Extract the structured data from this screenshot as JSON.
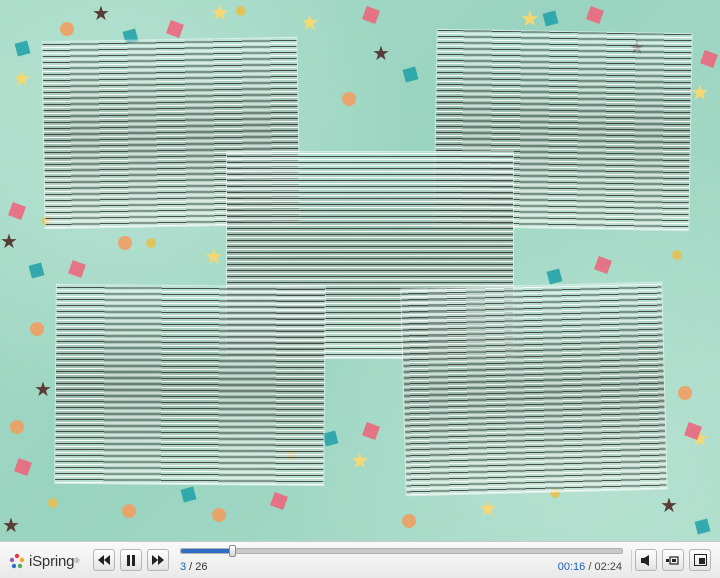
{
  "player": {
    "brand": "iSpring",
    "brand_mark": "®",
    "slide_current": "3",
    "slide_total": "26",
    "slide_sep": " / ",
    "time_elapsed": "00:16",
    "time_sep": " / ",
    "time_total": "02:24",
    "progress": 0.115
  },
  "icons": {
    "prev": "rewind-icon",
    "pause": "pause-icon",
    "next": "fast-forward-icon",
    "volume": "volume-icon",
    "layout": "layout-icon",
    "fullscreen": "fullscreen-icon"
  },
  "colors": {
    "accent": "#2f6dc6",
    "slide_background": "#9fd6c2"
  }
}
